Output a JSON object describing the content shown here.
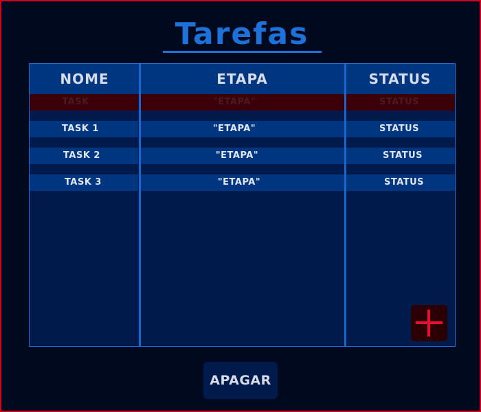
{
  "title": "Tarefas",
  "table": {
    "headers": [
      "NOME",
      "ETAPA",
      "STATUS"
    ],
    "placeholder_row": [
      "TASK",
      "\"ETAPA\"",
      "STATUS"
    ],
    "rows": [
      [
        "TASK 1",
        "\"ETAPA\"",
        "STATUS"
      ],
      [
        "TASK 2",
        "\"ETAPA\"",
        "STATUS"
      ],
      [
        "TASK 3",
        "\"ETAPA\"",
        "STATUS"
      ]
    ]
  },
  "buttons": {
    "add_icon": "plus-icon",
    "apagar_label": "APAGAR"
  },
  "colors": {
    "accent_blue": "#1c72d8",
    "danger_red": "#e8102e",
    "row_blue": "#003580",
    "placeholder_red": "#3b0008"
  }
}
